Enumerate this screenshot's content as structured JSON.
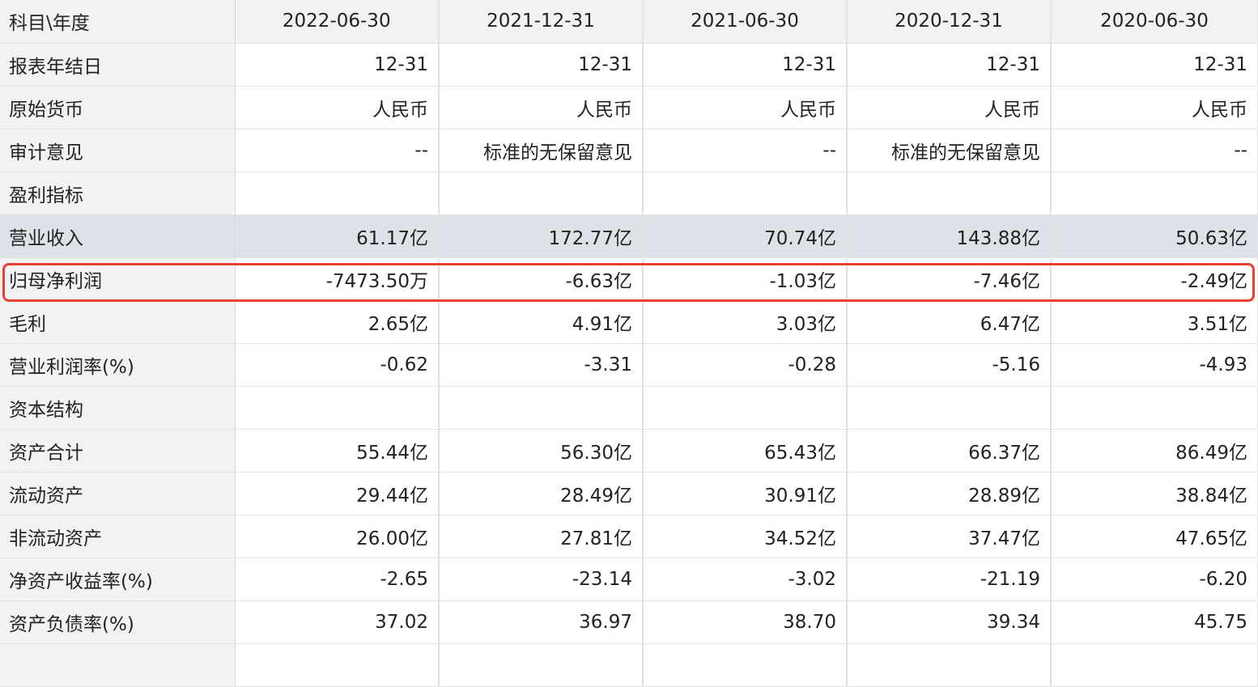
{
  "table": {
    "header": {
      "label": "科目\\年度",
      "columns": [
        "2022-06-30",
        "2021-12-31",
        "2021-06-30",
        "2020-12-31",
        "2020-06-30"
      ]
    },
    "rows": [
      {
        "label": "报表年结日",
        "values": [
          "12-31",
          "12-31",
          "12-31",
          "12-31",
          "12-31"
        ]
      },
      {
        "label": "原始货币",
        "values": [
          "人民币",
          "人民币",
          "人民币",
          "人民币",
          "人民币"
        ]
      },
      {
        "label": "审计意见",
        "values": [
          "--",
          "标准的无保留意见",
          "--",
          "标准的无保留意见",
          "--"
        ]
      },
      {
        "label": "盈利指标",
        "values": [
          "",
          "",
          "",
          "",
          ""
        ]
      },
      {
        "label": "营业收入",
        "values": [
          "61.17亿",
          "172.77亿",
          "70.74亿",
          "143.88亿",
          "50.63亿"
        ]
      },
      {
        "label": "归母净利润",
        "values": [
          "-7473.50万",
          "-6.63亿",
          "-1.03亿",
          "-7.46亿",
          "-2.49亿"
        ]
      },
      {
        "label": "毛利",
        "values": [
          "2.65亿",
          "4.91亿",
          "3.03亿",
          "6.47亿",
          "3.51亿"
        ]
      },
      {
        "label": "营业利润率(%)",
        "values": [
          "-0.62",
          "-3.31",
          "-0.28",
          "-5.16",
          "-4.93"
        ]
      },
      {
        "label": "资本结构",
        "values": [
          "",
          "",
          "",
          "",
          ""
        ]
      },
      {
        "label": "资产合计",
        "values": [
          "55.44亿",
          "56.30亿",
          "65.43亿",
          "66.37亿",
          "86.49亿"
        ]
      },
      {
        "label": "流动资产",
        "values": [
          "29.44亿",
          "28.49亿",
          "30.91亿",
          "28.89亿",
          "38.84亿"
        ]
      },
      {
        "label": "非流动资产",
        "values": [
          "26.00亿",
          "27.81亿",
          "34.52亿",
          "37.47亿",
          "47.65亿"
        ]
      },
      {
        "label": "净资产收益率(%)",
        "values": [
          "-2.65",
          "-23.14",
          "-3.02",
          "-21.19",
          "-6.20"
        ]
      },
      {
        "label": "资产负债率(%)",
        "values": [
          "37.02",
          "36.97",
          "38.70",
          "39.34",
          "45.75"
        ]
      },
      {
        "label": "",
        "values": [
          "",
          "",
          "",
          "",
          ""
        ]
      }
    ]
  },
  "colors": {
    "label_bg": "#f2f2f2",
    "highlight_row_bg": "#dde2e8",
    "annotation_box": "#e8412f",
    "grid_line": "#e3e3e3"
  }
}
